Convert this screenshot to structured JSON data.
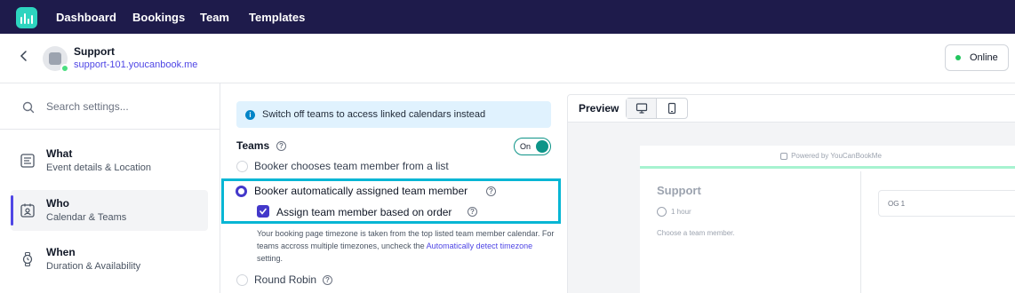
{
  "nav": {
    "links": [
      "Dashboard",
      "Bookings",
      "Team",
      "Templates"
    ]
  },
  "header": {
    "title": "Support",
    "url": "support-101.youcanbook.me",
    "status": "Online"
  },
  "sidebar": {
    "search_placeholder": "Search settings...",
    "items": [
      {
        "title": "What",
        "subtitle": "Event details & Location",
        "icon": "document-icon"
      },
      {
        "title": "Who",
        "subtitle": "Calendar & Teams",
        "icon": "calendar-person-icon"
      },
      {
        "title": "When",
        "subtitle": "Duration & Availability",
        "icon": "watch-icon"
      }
    ]
  },
  "main": {
    "info_banner": "Switch off teams to access linked calendars instead",
    "teams_label": "Teams",
    "toggle_label": "On",
    "options": {
      "list": "Booker chooses team member from a list",
      "auto": "Booker automatically assigned team member",
      "order": "Assign team member based on order",
      "round_robin": "Round Robin"
    },
    "note_prefix": "Your booking page timezone is taken from the top listed team member calendar. For teams accross multiple timezones, uncheck the ",
    "note_link": "Automatically detect timezone",
    "note_suffix": " setting."
  },
  "preview": {
    "title": "Preview",
    "powered": "Powered by YouCanBookMe",
    "card_title": "Support",
    "duration": "1 hour",
    "choose": "Choose a team member.",
    "member": "OG 1"
  },
  "colors": {
    "nav_bg": "#1e1b4b",
    "accent": "#4f46e5",
    "highlight": "#06b6d4",
    "toggle": "#0d9488"
  }
}
